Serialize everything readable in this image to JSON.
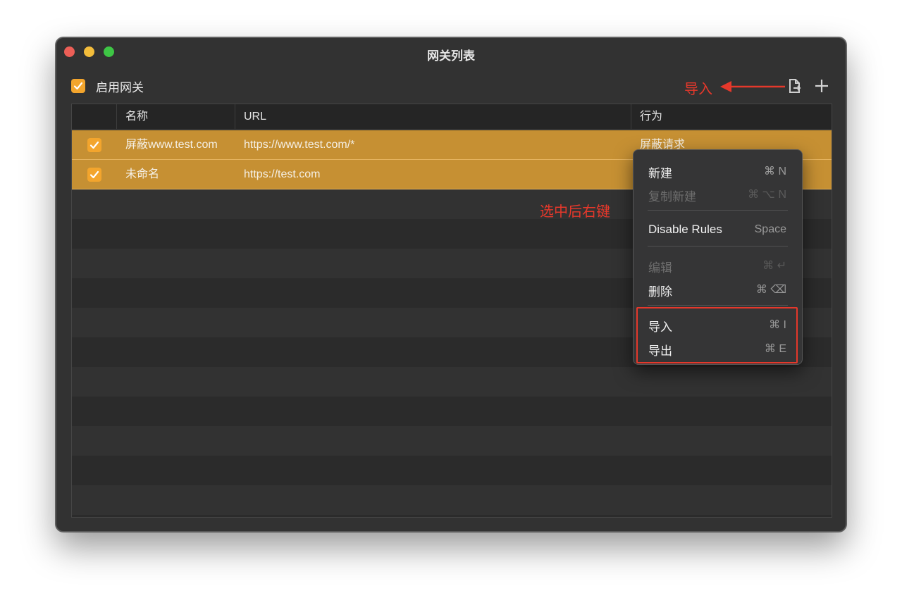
{
  "window": {
    "title": "网关列表",
    "enable_label": "启用网关",
    "enabled": true
  },
  "toolbar": {
    "icons": [
      "import-file-icon",
      "plus-icon"
    ]
  },
  "annotations": {
    "import_label": "导入",
    "select_hint": "选中后右键",
    "color": "#e5382b"
  },
  "table": {
    "columns": [
      "",
      "名称",
      "URL",
      "行为"
    ],
    "rows": [
      {
        "checked": true,
        "name": "屏蔽www.test.com",
        "url": "https://www.test.com/*",
        "action": "屏蔽请求"
      },
      {
        "checked": true,
        "name": "未命名",
        "url": "https://test.com",
        "action": ""
      }
    ]
  },
  "context_menu": {
    "items": [
      {
        "label": "新建",
        "shortcut": "⌘ N",
        "enabled": true
      },
      {
        "label": "复制新建",
        "shortcut": "⌘ ⌥ N",
        "enabled": false
      },
      {
        "label": "Disable Rules",
        "shortcut": "Space",
        "enabled": true
      },
      {
        "label": "编辑",
        "shortcut": "⌘ ↵",
        "enabled": false
      },
      {
        "label": "删除",
        "shortcut": "⌘ ⌫",
        "enabled": true
      },
      {
        "label": "导入",
        "shortcut": "⌘ I",
        "enabled": true
      },
      {
        "label": "导出",
        "shortcut": "⌘ E",
        "enabled": true
      }
    ]
  },
  "colors": {
    "accent": "#f3a52d",
    "selected_row": "#c69033",
    "window_bg": "#323232"
  }
}
